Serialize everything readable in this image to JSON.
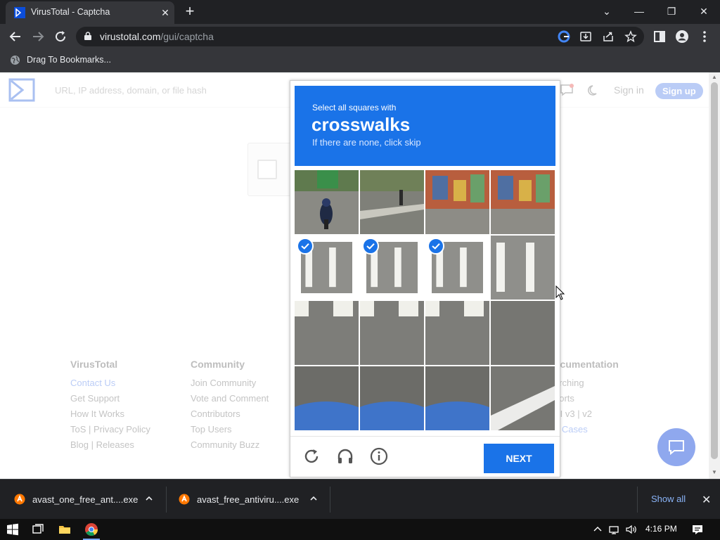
{
  "browser": {
    "tab_title": "VirusTotal - Captcha",
    "tab_close": "✕",
    "new_tab": "+",
    "url_domain": "virustotal.com",
    "url_path": "/gui/captcha",
    "bookmark_label": "Drag To Bookmarks...",
    "window_controls": {
      "dropdown": "⌄",
      "minimize": "—",
      "restore": "❐",
      "close": "✕"
    }
  },
  "page": {
    "search_placeholder": "URL, IP address, domain, or file hash",
    "sign_in": "Sign in",
    "sign_up": "Sign up",
    "notification_count": "2",
    "footer": [
      {
        "heading": "VirusTotal",
        "items": [
          "Contact Us",
          "Get Support",
          "How It Works",
          "ToS | Privacy Policy",
          "Blog | Releases"
        ]
      },
      {
        "heading": "Community",
        "items": [
          "Join Community",
          "Vote and Comment",
          "Contributors",
          "Top Users",
          "Community Buzz"
        ]
      },
      {
        "heading": "ocumentation",
        "items": [
          "arching",
          "ports",
          "PI v3 | v2",
          "e Cases"
        ]
      }
    ]
  },
  "captcha": {
    "instruction": "Select all squares with",
    "target": "crosswalks",
    "hint": "If there are none, click skip",
    "next_label": "NEXT",
    "tiles": [
      {
        "row": 0,
        "col": 0,
        "selected": false,
        "scene": "motorcycle-rider"
      },
      {
        "row": 0,
        "col": 1,
        "selected": false,
        "scene": "sidewalk-pedestrian"
      },
      {
        "row": 0,
        "col": 2,
        "selected": false,
        "scene": "mural-wall"
      },
      {
        "row": 0,
        "col": 3,
        "selected": false,
        "scene": "mural-wall"
      },
      {
        "row": 1,
        "col": 0,
        "selected": true,
        "scene": "crosswalk"
      },
      {
        "row": 1,
        "col": 1,
        "selected": true,
        "scene": "crosswalk"
      },
      {
        "row": 1,
        "col": 2,
        "selected": true,
        "scene": "crosswalk"
      },
      {
        "row": 1,
        "col": 3,
        "selected": false,
        "scene": "crosswalk"
      },
      {
        "row": 2,
        "col": 0,
        "selected": false,
        "scene": "crosswalk-edge"
      },
      {
        "row": 2,
        "col": 1,
        "selected": false,
        "scene": "crosswalk-edge"
      },
      {
        "row": 2,
        "col": 2,
        "selected": false,
        "scene": "crosswalk-edge"
      },
      {
        "row": 2,
        "col": 3,
        "selected": false,
        "scene": "asphalt"
      },
      {
        "row": 3,
        "col": 0,
        "selected": false,
        "scene": "car-hood"
      },
      {
        "row": 3,
        "col": 1,
        "selected": false,
        "scene": "car-hood"
      },
      {
        "row": 3,
        "col": 2,
        "selected": false,
        "scene": "car-hood"
      },
      {
        "row": 3,
        "col": 3,
        "selected": false,
        "scene": "road-line"
      }
    ]
  },
  "downloads": {
    "items": [
      {
        "name": "avast_one_free_ant....exe"
      },
      {
        "name": "avast_free_antiviru....exe"
      }
    ],
    "show_all": "Show all",
    "close": "✕"
  },
  "taskbar": {
    "time": "4:16 PM"
  },
  "colors": {
    "captcha_blue": "#1a73e8",
    "chrome_dark": "#202124",
    "chrome_toolbar": "#35363a",
    "download_link": "#8ab4f8"
  }
}
